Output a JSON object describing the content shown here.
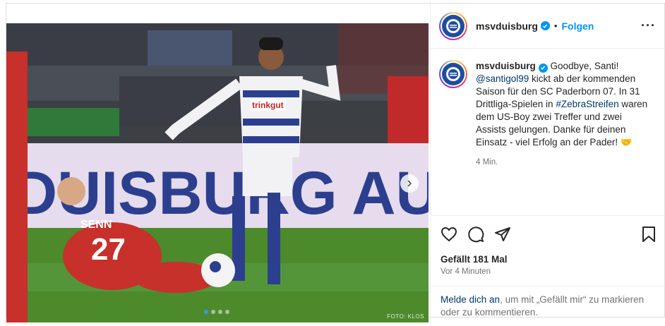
{
  "account": {
    "username": "msvduisburg",
    "follow_label": "Folgen",
    "separator": "•"
  },
  "caption": {
    "username": "msvduisburg",
    "text_1": "Goodbye, Santi!",
    "mention": "@santigol99",
    "text_2": " kickt ab der kommenden Saison für den SC Paderborn 07. In 31 Drittliga-Spielen in ",
    "hashtag": "#ZebraStreifen",
    "text_3": " waren dem US-Boy zwei Treffer und zwei Assists gelungen. Danke für deinen Einsatz - viel Erfolg an der Pader! 🤝",
    "time": "4 Min."
  },
  "stats": {
    "likes": "Gefällt 181 Mal",
    "date": "Vor 4 Minuten"
  },
  "login_prompt": {
    "link": "Melde dich an",
    "text": ", um mit „Gefällt mir“ zu markieren oder zu kommentieren."
  },
  "media": {
    "photo_credit": "FOTO: KLOS",
    "board_text": "DUISBURG AU",
    "shirt_sponsor": "trinkgut",
    "opponent_name": "SENN",
    "opponent_number": "27",
    "carousel_count": 4,
    "carousel_active": 1
  },
  "colors": {
    "accent": "#0095f6",
    "link": "#00376b",
    "msv_blue": "#1d4e9e"
  },
  "icons": [
    "heart-icon",
    "comment-icon",
    "share-icon",
    "save-icon",
    "more-icon",
    "verified-icon",
    "chevron-right-icon"
  ]
}
